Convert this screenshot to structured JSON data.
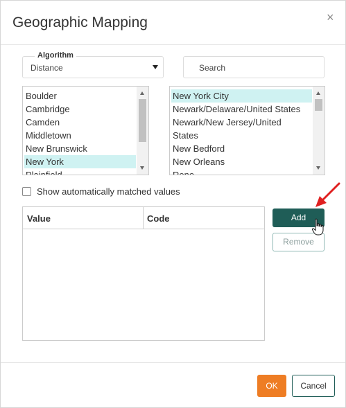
{
  "dialog": {
    "title": "Geographic Mapping",
    "close_glyph": "×"
  },
  "algorithm": {
    "legend": "Algorithm",
    "selected": "Distance"
  },
  "search": {
    "placeholder": "Search"
  },
  "left_list": {
    "items": [
      "Boulder",
      "Cambridge",
      "Camden",
      "Middletown",
      "New Brunswick",
      "New York",
      "Plainfield"
    ],
    "selected_index": 5
  },
  "right_list": {
    "items": [
      "New York City",
      "Newark/Delaware/United States",
      "Newark/New Jersey/United",
      "States",
      "New Bedford",
      "New Orleans",
      "Reno"
    ],
    "selected_index": 0
  },
  "options": {
    "show_auto_matched_label": "Show automatically matched values",
    "show_auto_matched_checked": false
  },
  "mapping_table": {
    "columns": [
      "Value",
      "Code"
    ],
    "rows": []
  },
  "actions": {
    "add_label": "Add",
    "remove_label": "Remove"
  },
  "footer": {
    "ok_label": "OK",
    "cancel_label": "Cancel"
  },
  "colors": {
    "selection": "#cff2f2",
    "primary": "#1f5d57",
    "ok": "#ee7d24",
    "annotation_arrow": "#e02020"
  },
  "icons": {
    "annotation": "red-arrow-icon",
    "pointer": "hand-cursor-icon",
    "dropdown": "caret-down-icon"
  }
}
